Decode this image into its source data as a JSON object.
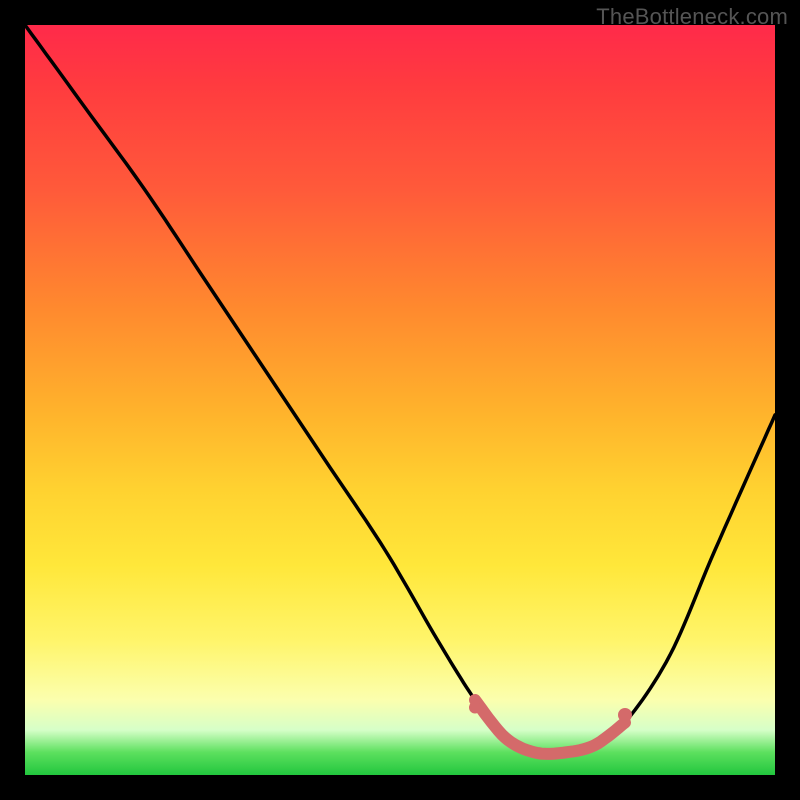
{
  "watermark": "TheBottleneck.com",
  "chart_data": {
    "type": "line",
    "title": "",
    "subtitle": "",
    "xlabel": "",
    "ylabel": "",
    "xlim": [
      0,
      100
    ],
    "ylim": [
      0,
      100
    ],
    "grid": false,
    "legend": false,
    "series": [
      {
        "name": "bottleneck-curve",
        "color": "#000000",
        "x": [
          0,
          8,
          16,
          24,
          32,
          40,
          48,
          55,
          60,
          64,
          68,
          72,
          76,
          80,
          86,
          92,
          100
        ],
        "y": [
          100,
          89,
          78,
          66,
          54,
          42,
          30,
          18,
          10,
          5,
          3,
          3,
          4,
          7,
          16,
          30,
          48
        ]
      }
    ],
    "markers": [
      {
        "name": "range-start-marker",
        "x": 60,
        "y": 9,
        "color": "#d46a6a",
        "r": 6
      },
      {
        "name": "range-mid-marker-a",
        "x": 64,
        "y": 5,
        "color": "#d46a6a",
        "r": 5
      },
      {
        "name": "range-mid-marker-b",
        "x": 68,
        "y": 3,
        "color": "#d46a6a",
        "r": 5
      },
      {
        "name": "range-mid-marker-c",
        "x": 72,
        "y": 3,
        "color": "#d46a6a",
        "r": 5
      },
      {
        "name": "range-mid-marker-d",
        "x": 76,
        "y": 4,
        "color": "#d46a6a",
        "r": 5
      },
      {
        "name": "range-end-marker",
        "x": 80,
        "y": 8,
        "color": "#d46a6a",
        "r": 7
      }
    ],
    "highlight_segment": {
      "from_x": 60,
      "to_x": 80,
      "color": "#d46a6a",
      "width": 12
    }
  }
}
